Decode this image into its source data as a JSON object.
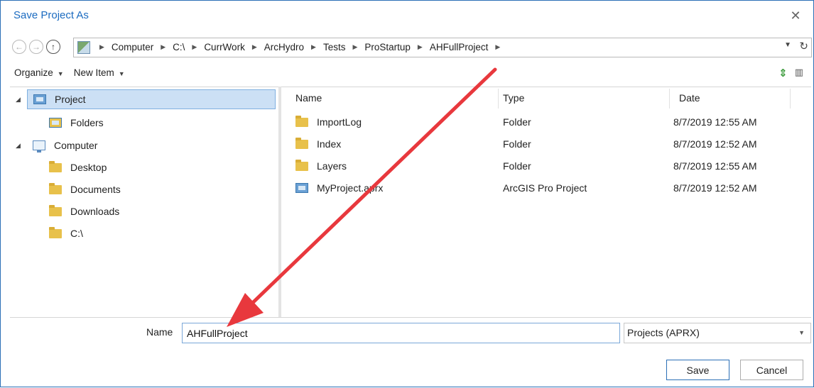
{
  "dialog": {
    "title": "Save Project As"
  },
  "address": {
    "crumbs": [
      "Computer",
      "C:\\",
      "CurrWork",
      "ArcHydro",
      "Tests",
      "ProStartup",
      "AHFullProject"
    ]
  },
  "toolbar": {
    "organize_label": "Organize",
    "new_item_label": "New Item"
  },
  "tree": {
    "items": [
      {
        "label": "Project"
      },
      {
        "label": "Folders"
      },
      {
        "label": "Computer"
      },
      {
        "label": "Desktop"
      },
      {
        "label": "Documents"
      },
      {
        "label": "Downloads"
      },
      {
        "label": "C:\\"
      }
    ]
  },
  "list": {
    "columns": [
      "Name",
      "Type",
      "Date"
    ],
    "rows": [
      {
        "name": "ImportLog",
        "type": "Folder",
        "date": "8/7/2019 12:55 AM"
      },
      {
        "name": "Index",
        "type": "Folder",
        "date": "8/7/2019 12:52 AM"
      },
      {
        "name": "Layers",
        "type": "Folder",
        "date": "8/7/2019 12:55 AM"
      },
      {
        "name": "MyProject.aprx",
        "type": "ArcGIS Pro Project",
        "date": "8/7/2019 12:52 AM"
      }
    ]
  },
  "save": {
    "name_label": "Name",
    "name_value": "AHFullProject",
    "type_value": "Projects (APRX)",
    "save_label": "Save",
    "cancel_label": "Cancel"
  },
  "colors": {
    "accent": "#1b6bc0",
    "selection": "#cce0f5",
    "annotation_arrow": "#e8383d"
  }
}
